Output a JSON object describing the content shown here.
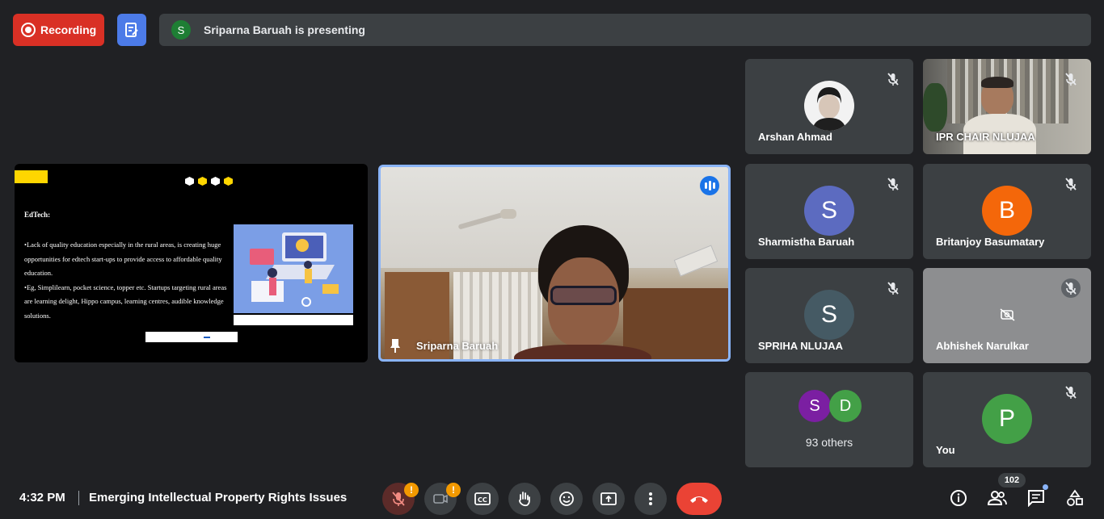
{
  "recording": {
    "label": "Recording"
  },
  "presenting_bar": {
    "avatar_letter": "S",
    "text": "Sriparna Baruah is presenting"
  },
  "slide": {
    "title": "EdTech:",
    "bullets": [
      "•Lack of quality education especially in the rural areas, is creating huge opportunities for edtech start-ups to provide access to affordable quality education.",
      "•Eg, Simplilearn, pocket science, topper etc. Startups targeting rural areas are learning delight, Hippo campus, learning centres, audible knowledge solutions."
    ],
    "dot_colors": [
      "#ffffff",
      "#ffd600",
      "#ffffff",
      "#ffd600"
    ],
    "accent_color": "#ffd600"
  },
  "main_video": {
    "name": "Sriparna Baruah",
    "speaking": true
  },
  "participants": [
    {
      "name": "Arshan Ahmad",
      "type": "photo",
      "muted": true
    },
    {
      "name": "IPR CHAIR NLUJAA",
      "type": "video",
      "muted": true
    },
    {
      "name": "Sharmistha Baruah",
      "letter": "S",
      "color": "#5c6bc0",
      "muted": true
    },
    {
      "name": "Britanjoy Basumatary",
      "letter": "B",
      "color": "#f4670a",
      "muted": true
    },
    {
      "name": "SPRIHA NLUJAA",
      "letter": "S",
      "color": "#455a64",
      "muted": true
    },
    {
      "name": "Abhishek Narulkar",
      "type": "camera-off",
      "muted": true
    },
    {
      "others_label": "93 others",
      "letters": [
        "S",
        "D"
      ],
      "colors": [
        "#7b1fa2",
        "#43a047"
      ]
    },
    {
      "name": "You",
      "letter": "P",
      "color": "#43a047",
      "muted": true
    }
  ],
  "bottom": {
    "time": "4:32 PM",
    "meeting_title": "Emerging Intellectual Property Rights Issues",
    "participant_count": "102",
    "warning_mark": "!"
  },
  "icons": {
    "mic": "mic-off-icon",
    "camera": "camera-off-icon",
    "captions": "captions-icon",
    "hand": "raise-hand-icon",
    "emoji": "emoji-icon",
    "present": "present-icon",
    "more": "more-vert-icon",
    "leave": "call-end-icon",
    "info": "info-icon",
    "people": "people-icon",
    "chat": "chat-icon",
    "activities": "activities-icon"
  }
}
